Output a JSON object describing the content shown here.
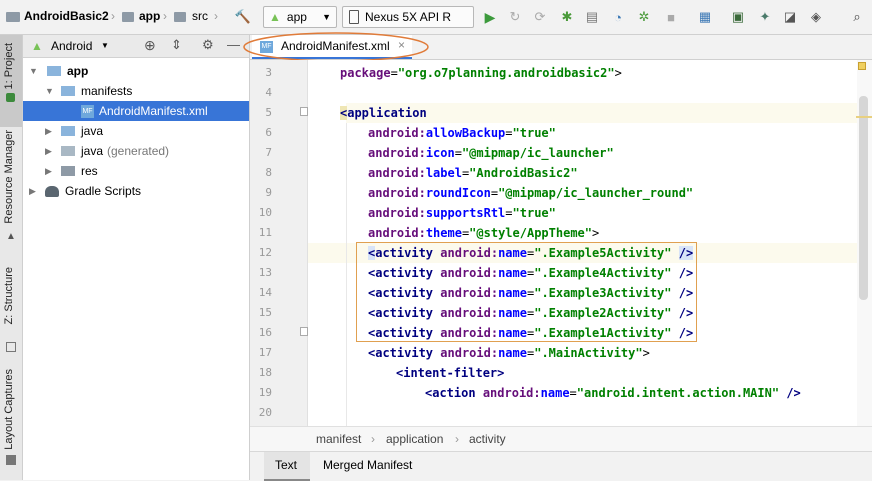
{
  "navbar": {
    "project": "AndroidBasic2",
    "module": "app",
    "folder": "src",
    "run_config": "app",
    "device": "Nexus 5X API R"
  },
  "left_tools": {
    "project": "1: Project",
    "resource_manager": "Resource Manager",
    "structure": "Z: Structure",
    "layout_captures": "Layout Captures"
  },
  "project_panel": {
    "view_mode": "Android",
    "tree": [
      {
        "label": "app",
        "bold": true
      },
      {
        "label": "manifests"
      },
      {
        "label": "AndroidManifest.xml"
      },
      {
        "label": "java"
      },
      {
        "label": "java",
        "suffix": "(generated)"
      },
      {
        "label": "res"
      },
      {
        "label": "Gradle Scripts"
      }
    ]
  },
  "editor": {
    "tab_label": "AndroidManifest.xml",
    "line_numbers": [
      "3",
      "4",
      "5",
      "6",
      "7",
      "8",
      "9",
      "10",
      "11",
      "12",
      "13",
      "14",
      "15",
      "16",
      "17",
      "18",
      "19",
      "20"
    ],
    "lines": {
      "l3_attr": "package",
      "l3_value": "\"org.o7planning.androidbasic2\"",
      "l5_tag": "application",
      "l6_attr": "allowBackup",
      "l6_value": "\"true\"",
      "l7_attr": "icon",
      "l7_value": "\"@mipmap/ic_launcher\"",
      "l8_attr": "label",
      "l8_value": "\"AndroidBasic2\"",
      "l9_attr": "roundIcon",
      "l9_value": "\"@mipmap/ic_launcher_round\"",
      "l10_attr": "supportsRtl",
      "l10_value": "\"true\"",
      "l11_attr": "theme",
      "l11_value": "\"@style/AppTheme\"",
      "activity_tag": "activity",
      "name_attr": "name",
      "act5": "\".Example5Activity\"",
      "act4": "\".Example4Activity\"",
      "act3": "\".Example3Activity\"",
      "act2": "\".Example2Activity\"",
      "act1": "\".Example1Activity\"",
      "act_main": "\".MainActivity\"",
      "l18_tag": "intent-filter",
      "l19_tag": "action",
      "l19_value": "\"android.intent.action.MAIN\"",
      "ns": "android"
    }
  },
  "breadcrumb": [
    "manifest",
    "application",
    "activity"
  ],
  "bottom_tabs": [
    "Text",
    "Merged Manifest"
  ],
  "colors": {
    "selection": "#3875d7",
    "callout_circle": "#e07b39",
    "highlight_box": "#e0a050"
  }
}
